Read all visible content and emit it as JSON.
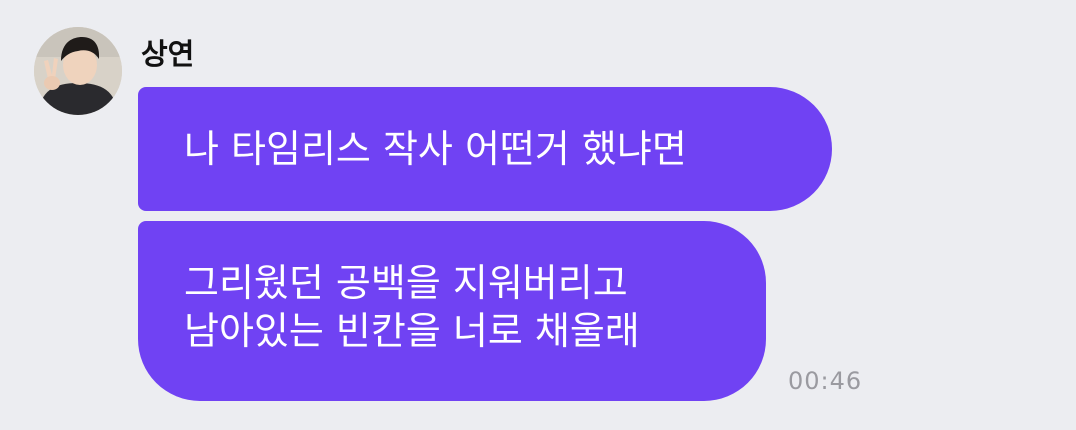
{
  "chat": {
    "sender": {
      "name": "상연",
      "avatar": "profile-photo"
    },
    "messages": [
      {
        "lines": [
          "나 타임리스 작사 어떤거 했냐면"
        ]
      },
      {
        "lines": [
          "그리웠던 공백을 지워버리고",
          "남아있는 빈칸을 너로 채울래"
        ]
      }
    ],
    "timestamp": "00:46",
    "colors": {
      "background": "#ecedf1",
      "bubble": "#7042f3",
      "bubble_text": "#ffffff",
      "timestamp": "#9a9aa0"
    }
  }
}
